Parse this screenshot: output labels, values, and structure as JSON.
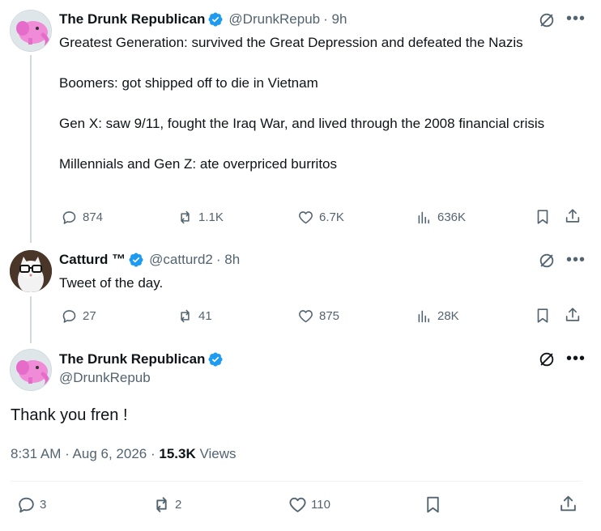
{
  "tweet1": {
    "name": "The Drunk Republican",
    "handle": "@DrunkRepub",
    "time": "· 9h",
    "lines": [
      "Greatest Generation: survived the Great Depression and defeated the Nazis",
      "Boomers: got shipped off to die in Vietnam",
      "Gen X: saw 9/11, fought the Iraq War, and lived through the 2008 financial crisis",
      "Millennials and Gen Z: ate overpriced burritos"
    ],
    "replies": "874",
    "retweets": "1.1K",
    "likes": "6.7K",
    "views": "636K"
  },
  "tweet2": {
    "name": "Catturd ™",
    "handle": "@catturd2",
    "time": "· 8h",
    "text": "Tweet of the day.",
    "replies": "27",
    "retweets": "41",
    "likes": "875",
    "views": "28K"
  },
  "main_tweet": {
    "name": "The Drunk Republican",
    "handle": "@DrunkRepub",
    "text": "Thank you fren !",
    "timestamp": "8:31 AM · Aug 6, 2026",
    "dot": "·",
    "views_count": "15.3K",
    "views_label": "Views",
    "replies": "3",
    "retweets": "2",
    "likes": "110"
  },
  "colors": {
    "verified": "#1d9bf0",
    "text_primary": "#0f1419",
    "text_secondary": "#536471"
  }
}
